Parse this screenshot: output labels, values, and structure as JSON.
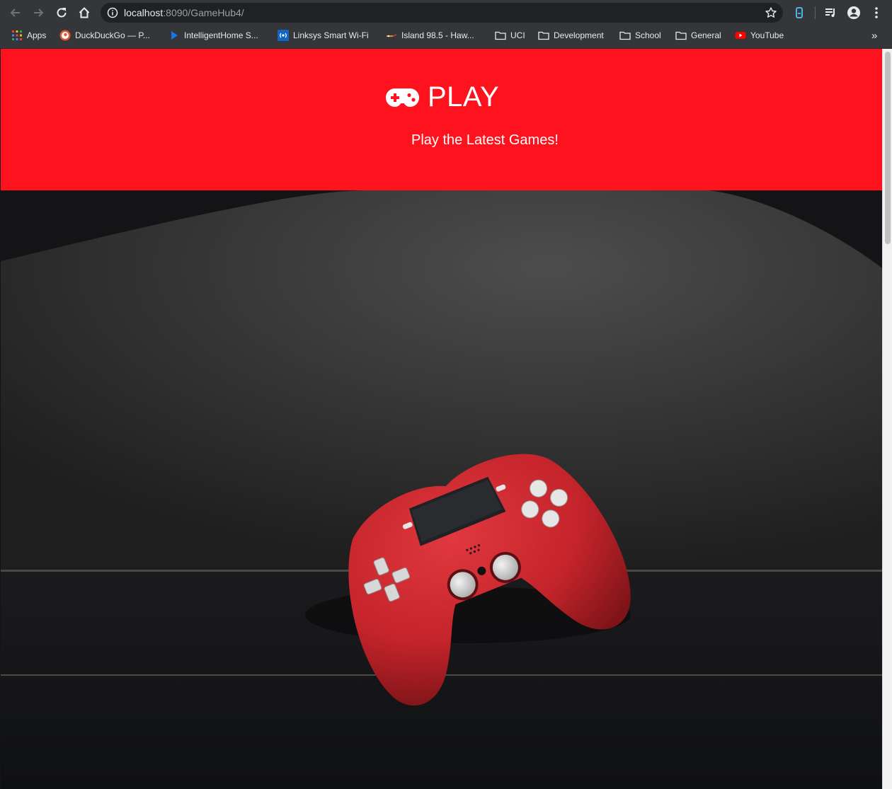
{
  "browser": {
    "url_host": "localhost",
    "url_rest": ":8090/GameHub4/",
    "icons": {
      "back": "arrow-left-icon",
      "forward": "arrow-right-icon",
      "reload": "reload-icon",
      "home": "home-icon",
      "info": "info-icon",
      "star": "star-icon",
      "extension": "extension-icon",
      "media": "media-control-icon",
      "profile": "profile-icon",
      "menu": "kebab-menu-icon"
    }
  },
  "bookmarks": [
    {
      "label": "Apps",
      "icon": "apps-grid-icon"
    },
    {
      "label": "DuckDuckGo — P...",
      "icon": "duckduckgo-icon"
    },
    {
      "label": "IntelligentHome S...",
      "icon": "play-triangle-icon"
    },
    {
      "label": "Linksys Smart Wi-Fi",
      "icon": "wifi-icon"
    },
    {
      "label": "Island 98.5 - Haw...",
      "icon": "radio-icon"
    },
    {
      "label": "UCI",
      "icon": "folder-icon"
    },
    {
      "label": "Development",
      "icon": "folder-icon"
    },
    {
      "label": "School",
      "icon": "folder-icon"
    },
    {
      "label": "General",
      "icon": "folder-icon"
    },
    {
      "label": "YouTube",
      "icon": "youtube-icon"
    }
  ],
  "bookmarks_overflow": "»",
  "page": {
    "brand_title": "PLAY",
    "brand_icon": "gamepad-icon",
    "tagline": "Play the Latest Games!",
    "colors": {
      "header_bg": "#fd121e",
      "text": "#ffffff",
      "controller": "#c4242b"
    }
  }
}
